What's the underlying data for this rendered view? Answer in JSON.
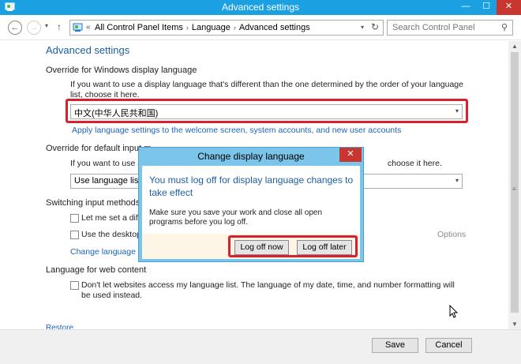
{
  "window": {
    "title": "Advanced settings",
    "minimize_glyph": "—",
    "maximize_glyph": "☐",
    "close_glyph": "✕"
  },
  "nav": {
    "back_glyph": "←",
    "forward_glyph": "→",
    "recent_glyph": "▾",
    "up_glyph": "↑",
    "breadcrumb_chevron": "«",
    "breadcrumbs": [
      "All Control Panel Items",
      "Language",
      "Advanced settings"
    ],
    "crumb_separator": "›",
    "dropdown_glyph": "▾",
    "refresh_glyph": "↻",
    "search_placeholder": "Search Control Panel",
    "search_glyph": "⚲"
  },
  "main": {
    "page_title": "Advanced settings",
    "display_language": {
      "heading": "Override for Windows display language",
      "description": "If you want to use a display language that's different than the one determined by the order of your language list, choose it here.",
      "selected": "中文(中华人民共和国)",
      "link": "Apply language settings to the welcome screen, system accounts, and new user accounts"
    },
    "input_method": {
      "heading_visible": "Override for default input m",
      "description_left": "If you want to use ar",
      "description_right": "choose it here.",
      "selected_visible": "Use language list (re"
    },
    "switching": {
      "heading": "Switching input methods",
      "option1_visible": "Let me set a diffe",
      "option2_visible": "Use the desktop l",
      "options_link": "Options",
      "link_visible": "Change language ba"
    },
    "web_content": {
      "heading": "Language for web content",
      "option": "Don't let websites access my language list. The language of my date, time, and number formatting will be used instead."
    },
    "partial_link": "Restore defaults"
  },
  "dialog": {
    "title": "Change display language",
    "close_glyph": "✕",
    "heading": "You must log off for display language changes to take effect",
    "message": "Make sure you save your work and close all open programs before you log off.",
    "log_off_now": "Log off now",
    "log_off_later": "Log off later"
  },
  "footer": {
    "save": "Save",
    "cancel": "Cancel"
  },
  "scrollbar": {
    "up_glyph": "▲",
    "down_glyph": "▼",
    "grip_glyph": "≡"
  },
  "colors": {
    "titlebar": "#1ba1e2",
    "dialog_frame": "#7bc4ea",
    "highlight_box": "#d6212e",
    "link": "#1a64b8",
    "heading": "#1e5fa0"
  }
}
